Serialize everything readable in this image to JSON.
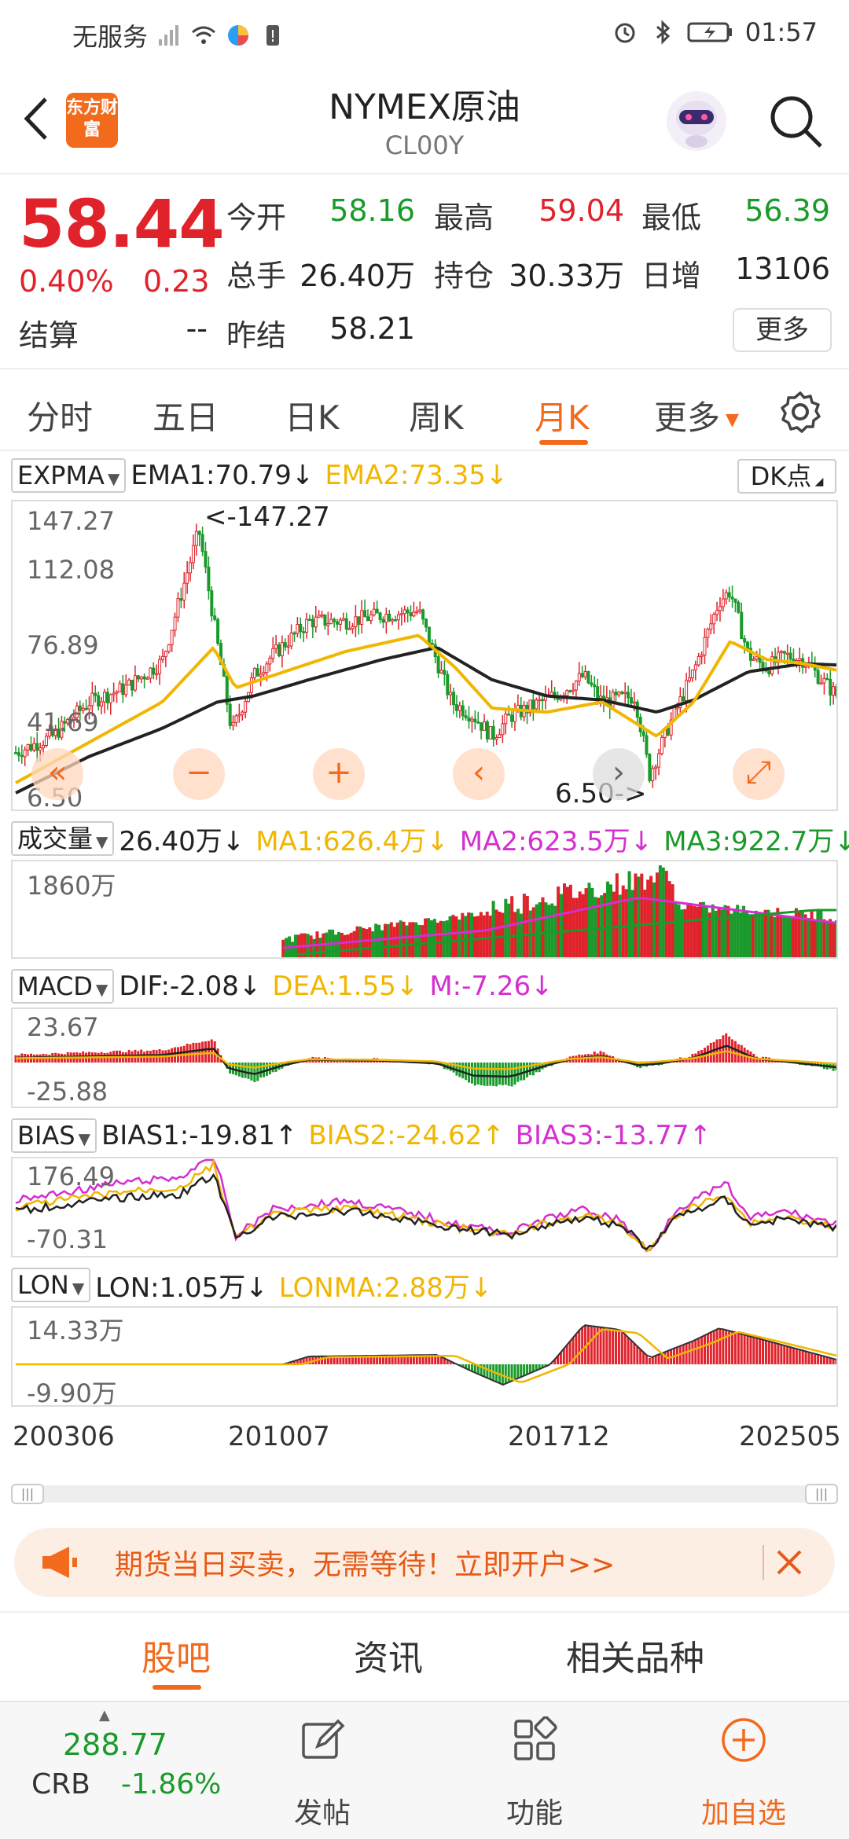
{
  "statusbar": {
    "carrier": "无服务",
    "time": "01:57"
  },
  "header": {
    "logo_text": "东方财富",
    "title": "NYMEX原油",
    "code": "CL00Y"
  },
  "quote": {
    "price": "58.44",
    "change_pct": "0.40%",
    "change": "0.23",
    "settle_label": "结算",
    "settle_value": "--",
    "open_label": "今开",
    "open_value": "58.16",
    "high_label": "最高",
    "high_value": "59.04",
    "low_label": "最低",
    "low_value": "56.39",
    "volume_label": "总手",
    "volume_value": "26.40万",
    "oi_label": "持仓",
    "oi_value": "30.33万",
    "daily_inc_label": "日增",
    "daily_inc_value": "13106",
    "prev_settle_label": "昨结",
    "prev_settle_value": "58.21",
    "more_button": "更多"
  },
  "tabs": {
    "items": [
      "分时",
      "五日",
      "日K",
      "周K",
      "月K",
      "更多"
    ],
    "active": "月K"
  },
  "indicators": {
    "expma": {
      "selector": "EXPMA",
      "ema1": "EMA1:70.79↓",
      "ema2": "EMA2:73.35↓",
      "dk": "DK点"
    },
    "volume": {
      "selector": "成交量",
      "value": "26.40万↓",
      "ma1": "MA1:626.4万↓",
      "ma2": "MA2:623.5万↓",
      "ma3": "MA3:922.7万↓"
    },
    "macd": {
      "selector": "MACD",
      "dif": "DIF:-2.08↓",
      "dea": "DEA:1.55↓",
      "m": "M:-7.26↓"
    },
    "bias": {
      "selector": "BIAS",
      "bias1": "BIAS1:-19.81↑",
      "bias2": "BIAS2:-24.62↑",
      "bias3": "BIAS3:-13.77↑"
    },
    "lon": {
      "selector": "LON",
      "lon": "LON:1.05万↓",
      "lonma": "LONMA:2.88万↓"
    }
  },
  "chart_data": [
    {
      "type": "candlestick",
      "name": "EXPMA",
      "y_ticks": [
        "147.27",
        "112.08",
        "76.89",
        "41.69",
        "6.50"
      ],
      "ylim": [
        6.5,
        147.27
      ],
      "max_annotation": "<-147.27",
      "min_annotation": "6.50->",
      "x_ticks": [
        "200306",
        "201007",
        "201712",
        "202505"
      ],
      "close_path": [
        [
          2003,
          30
        ],
        [
          2004,
          38
        ],
        [
          2005,
          55
        ],
        [
          2006,
          62
        ],
        [
          2007,
          75
        ],
        [
          2008,
          140
        ],
        [
          2008.9,
          40
        ],
        [
          2009.5,
          68
        ],
        [
          2010,
          78
        ],
        [
          2011,
          95
        ],
        [
          2012,
          95
        ],
        [
          2013,
          98
        ],
        [
          2014,
          100
        ],
        [
          2014.9,
          55
        ],
        [
          2015.5,
          48
        ],
        [
          2016,
          38
        ],
        [
          2016.5,
          48
        ],
        [
          2017,
          52
        ],
        [
          2017.9,
          60
        ],
        [
          2018.5,
          68
        ],
        [
          2019,
          55
        ],
        [
          2019.9,
          58
        ],
        [
          2020.3,
          19
        ],
        [
          2020.8,
          42
        ],
        [
          2021.5,
          70
        ],
        [
          2022.2,
          105
        ],
        [
          2022.5,
          110
        ],
        [
          2023,
          78
        ],
        [
          2023.5,
          72
        ],
        [
          2024,
          78
        ],
        [
          2024.5,
          76
        ],
        [
          2025,
          66
        ],
        [
          2025.4,
          58.44
        ]
      ],
      "ema1_path": [
        [
          2003,
          15
        ],
        [
          2005,
          35
        ],
        [
          2007,
          55
        ],
        [
          2008.4,
          82
        ],
        [
          2009,
          62
        ],
        [
          2010,
          68
        ],
        [
          2012,
          80
        ],
        [
          2014,
          88
        ],
        [
          2015,
          72
        ],
        [
          2016,
          52
        ],
        [
          2017.5,
          50
        ],
        [
          2019,
          55
        ],
        [
          2020.5,
          38
        ],
        [
          2021.5,
          55
        ],
        [
          2022.5,
          85
        ],
        [
          2023.5,
          76
        ],
        [
          2024.5,
          74
        ],
        [
          2025.4,
          70.79
        ]
      ],
      "ema2_path": [
        [
          2003,
          10
        ],
        [
          2005,
          28
        ],
        [
          2007,
          42
        ],
        [
          2008.5,
          55
        ],
        [
          2009.5,
          58
        ],
        [
          2011,
          66
        ],
        [
          2013,
          76
        ],
        [
          2014.5,
          82
        ],
        [
          2016,
          66
        ],
        [
          2017.5,
          58
        ],
        [
          2019,
          56
        ],
        [
          2020.5,
          50
        ],
        [
          2021.5,
          56
        ],
        [
          2023,
          70
        ],
        [
          2024.5,
          74
        ],
        [
          2025.4,
          73.35
        ]
      ]
    },
    {
      "type": "bar",
      "name": "成交量",
      "y_ticks": [
        "1860万"
      ],
      "units": "万"
    },
    {
      "type": "bar",
      "name": "MACD",
      "y_ticks": [
        "23.67",
        "-25.88"
      ],
      "ylim": [
        -25.88,
        23.67
      ]
    },
    {
      "type": "line",
      "name": "BIAS",
      "y_ticks": [
        "176.49",
        "-70.31"
      ],
      "ylim": [
        -70.31,
        176.49
      ]
    },
    {
      "type": "bar",
      "name": "LON",
      "y_ticks": [
        "14.33万",
        "-9.90万"
      ],
      "ylim": [
        -9.9,
        14.33
      ]
    }
  ],
  "colors": {
    "up": "#e0222b",
    "down": "#1a9a2a",
    "accent": "#f26a1b",
    "ema1": "#222222",
    "ema2": "#f1b600",
    "ma2": "#d42fd0"
  },
  "banner": {
    "text": "期货当日买卖，无需等待！立即开户>>"
  },
  "bottom_tabs": {
    "items": [
      "股吧",
      "资讯",
      "相关品种"
    ],
    "active": "股吧"
  },
  "bottombar": {
    "crb_value": "288.77",
    "crb_name": "CRB",
    "crb_pct": "-1.86%",
    "post": "发帖",
    "functions": "功能",
    "add_watch": "加自选"
  }
}
